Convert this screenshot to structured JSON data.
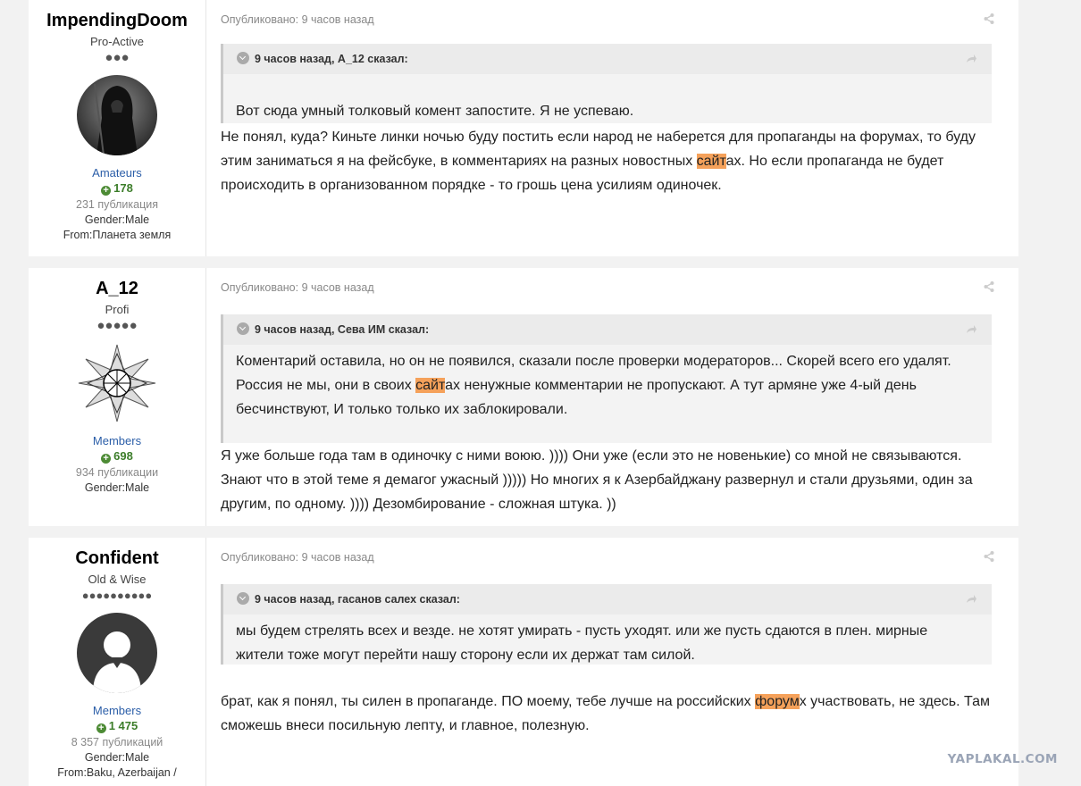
{
  "posts": [
    {
      "author": {
        "name": "ImpendingDoom",
        "rank": "Pro-Active",
        "pips": "●●●",
        "avatar_icon": "grim-reaper-avatar",
        "group": "Amateurs",
        "reputation": "178",
        "post_count": "231 публикация",
        "gender": "Gender:Male",
        "from": "From:Планета земля"
      },
      "posted": "Опубликовано: 9 часов назад",
      "quote": {
        "header": "9 часов назад, A_12 сказал:",
        "lines": [
          "Вот сюда умный толковый комент запостите. Я не успеваю."
        ]
      },
      "body": {
        "before": "Не понял, куда? Киньте линки ночью буду постить если народ не наберется для пропаганды на форумах, то буду этим заниматься я на фейсбуке, в комментариях на разных новостных ",
        "highlight": "сайт",
        "after": "ах. Но если пропаганда не будет происходить в организованном порядке - то грошь цена усилиям одиночек."
      }
    },
    {
      "author": {
        "name": "A_12",
        "rank": "Profi",
        "pips": "●●●●●",
        "avatar_icon": "star-mandala-avatar",
        "group": "Members",
        "reputation": "698",
        "post_count": "934 публикации",
        "gender": "Gender:Male"
      },
      "posted": "Опубликовано: 9 часов назад",
      "quote": {
        "header": "9 часов назад, Сева ИМ сказал:",
        "line1": "Коментарий оставила, но он не появился, сказали после проверки модераторов... Скорей всего его удалят.",
        "line2_before": "Россия не мы, они в своих ",
        "line2_highlight": "сайт",
        "line2_after": "ах ненужные комментарии не пропускают. А тут армяне уже 4-ый день бесчинствуют, И только только их заблокировали."
      },
      "body": {
        "text": "Я уже больше года там в одиночку с ними воюю. )))) Они уже (если это не новенькие) со мной не связываются. Знают что в этой теме я демагог ужасный ))))) Но многих я к Азербайджану развернул и стали друзьями, один за другим, по одному. )))) Дезомбирование - сложная штука. ))"
      }
    },
    {
      "author": {
        "name": "Confident",
        "rank": "Old & Wise",
        "pips": "●●●●●●●●●●",
        "avatar_icon": "default-user-avatar",
        "group": "Members",
        "reputation": "1 475",
        "post_count": "8 357 публикаций",
        "gender": "Gender:Male",
        "from": "From:Baku, Azerbaijan /"
      },
      "posted": "Опубликовано: 9 часов назад",
      "quote": {
        "header": "9 часов назад, гасанов салех сказал:",
        "lines": [
          "мы будем стрелять всех и везде. не хотят умирать - пусть уходят. или же пусть сдаются в плен. мирные жители тоже могут перейти нашу сторону если их держат там силой."
        ]
      },
      "body": {
        "before": "брат, как я понял, ты силен в пропаганде. ПО моему, тебе лучше на российских ",
        "highlight": "форум",
        "after": "х участвовать, не здесь. Там сможешь внеси посильную лепту, и главное, полезную."
      }
    }
  ],
  "watermark": "YAPLAKAL.COM",
  "colors": {
    "accent_group": "#2b5ea8",
    "reputation": "#3c7d2a",
    "highlight": "#f5a15a"
  }
}
